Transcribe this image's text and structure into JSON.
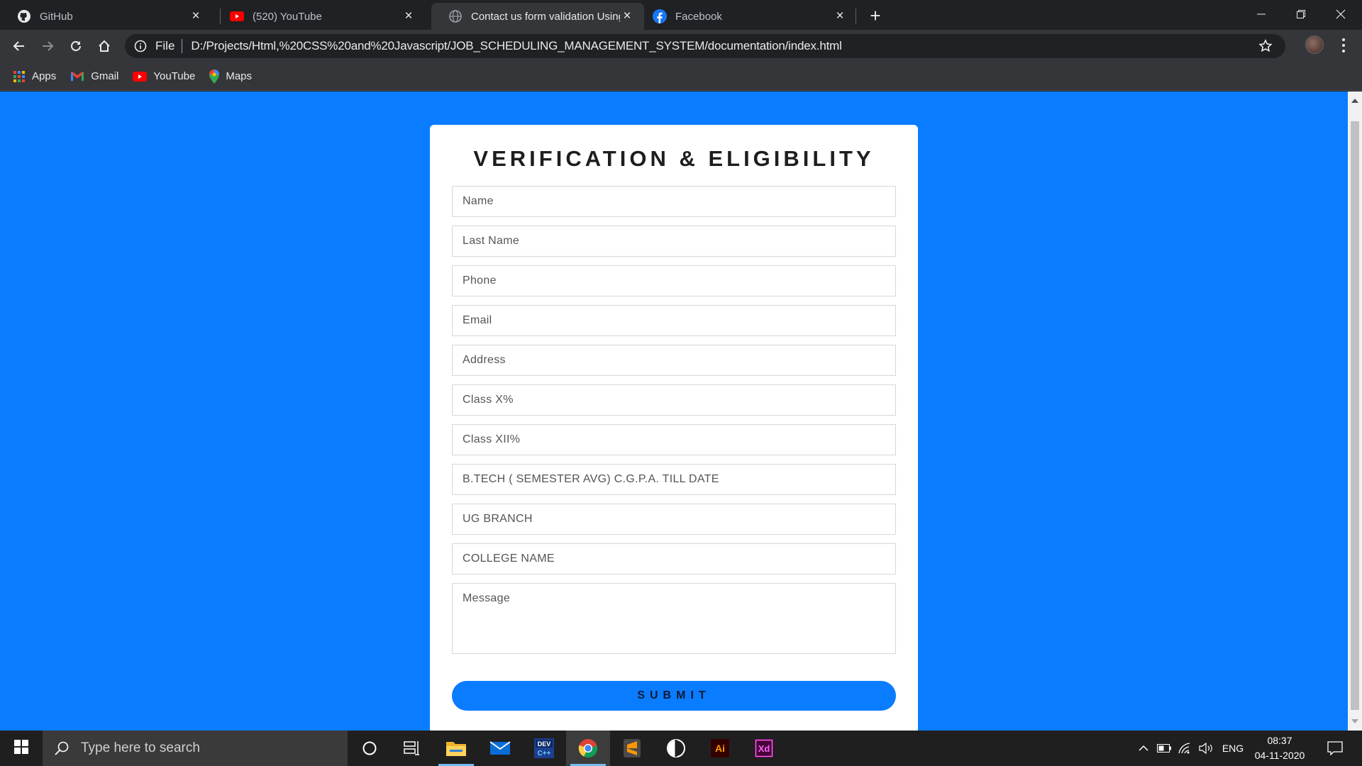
{
  "browser": {
    "tabs": [
      {
        "title": "GitHub",
        "icon": "github-icon"
      },
      {
        "title": "(520) YouTube",
        "icon": "youtube-icon"
      },
      {
        "title": "Contact us form validation Using",
        "icon": "globe-icon",
        "active": true
      },
      {
        "title": "Facebook",
        "icon": "facebook-icon"
      }
    ],
    "address": {
      "scheme": "File",
      "url": "D:/Projects/Html,%20CSS%20and%20Javascript/JOB_SCHEDULING_MANAGEMENT_SYSTEM/documentation/index.html"
    },
    "bookmarks": [
      {
        "label": "Apps",
        "icon": "apps-grid-icon"
      },
      {
        "label": "Gmail",
        "icon": "gmail-icon"
      },
      {
        "label": "YouTube",
        "icon": "youtube-icon"
      },
      {
        "label": "Maps",
        "icon": "maps-icon"
      }
    ]
  },
  "form": {
    "title": "VERIFICATION & ELIGIBILITY",
    "fields": {
      "name": "Name",
      "last_name": "Last Name",
      "phone": "Phone",
      "email": "Email",
      "address": "Address",
      "class_x": "Class X%",
      "class_xii": "Class XII%",
      "cgpa": "B.TECH ( SEMESTER AVG) C.G.P.A. TILL DATE",
      "ug_branch": "UG BRANCH",
      "college": "COLLEGE NAME",
      "message": "Message"
    },
    "submit_label": "SUBMIT"
  },
  "taskbar": {
    "search_placeholder": "Type here to search",
    "apps": [
      "cortana-icon",
      "task-view-icon",
      "file-explorer-icon",
      "mail-icon",
      "dev-c-icon",
      "chrome-icon",
      "sublime-text-icon",
      "davinci-icon",
      "illustrator-icon",
      "adobe-xd-icon"
    ],
    "tray": {
      "language": "ENG",
      "time": "08:37",
      "date": "04-11-2020"
    }
  },
  "colors": {
    "page_background": "#0a7cff",
    "card": "#ffffff",
    "submit_button": "#0a7cff",
    "chrome_dark": "#202124",
    "chrome_toolbar": "#35363a",
    "taskbar": "#1f1f1f"
  }
}
